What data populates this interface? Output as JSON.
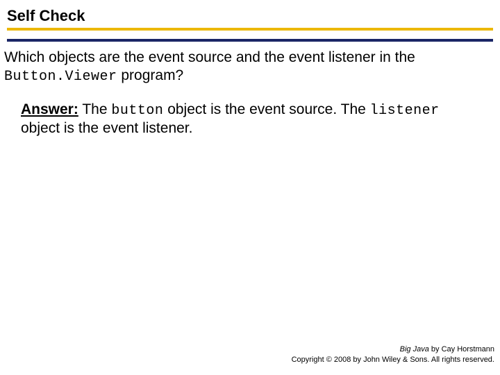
{
  "title": "Self Check",
  "question": {
    "part1": "Which objects are the event source and the event listener in the ",
    "code": "Button.Viewer",
    "part2": " program?"
  },
  "answer": {
    "label": "Answer:",
    "part1": " The ",
    "code1": "button",
    "part2": " object is the event source. The ",
    "code2": "listener",
    "part3": " object is the event listener."
  },
  "footer": {
    "book": "Big Java",
    "author": " by Cay Horstmann",
    "copyright": "Copyright © 2008 by John Wiley & Sons. All rights reserved."
  }
}
